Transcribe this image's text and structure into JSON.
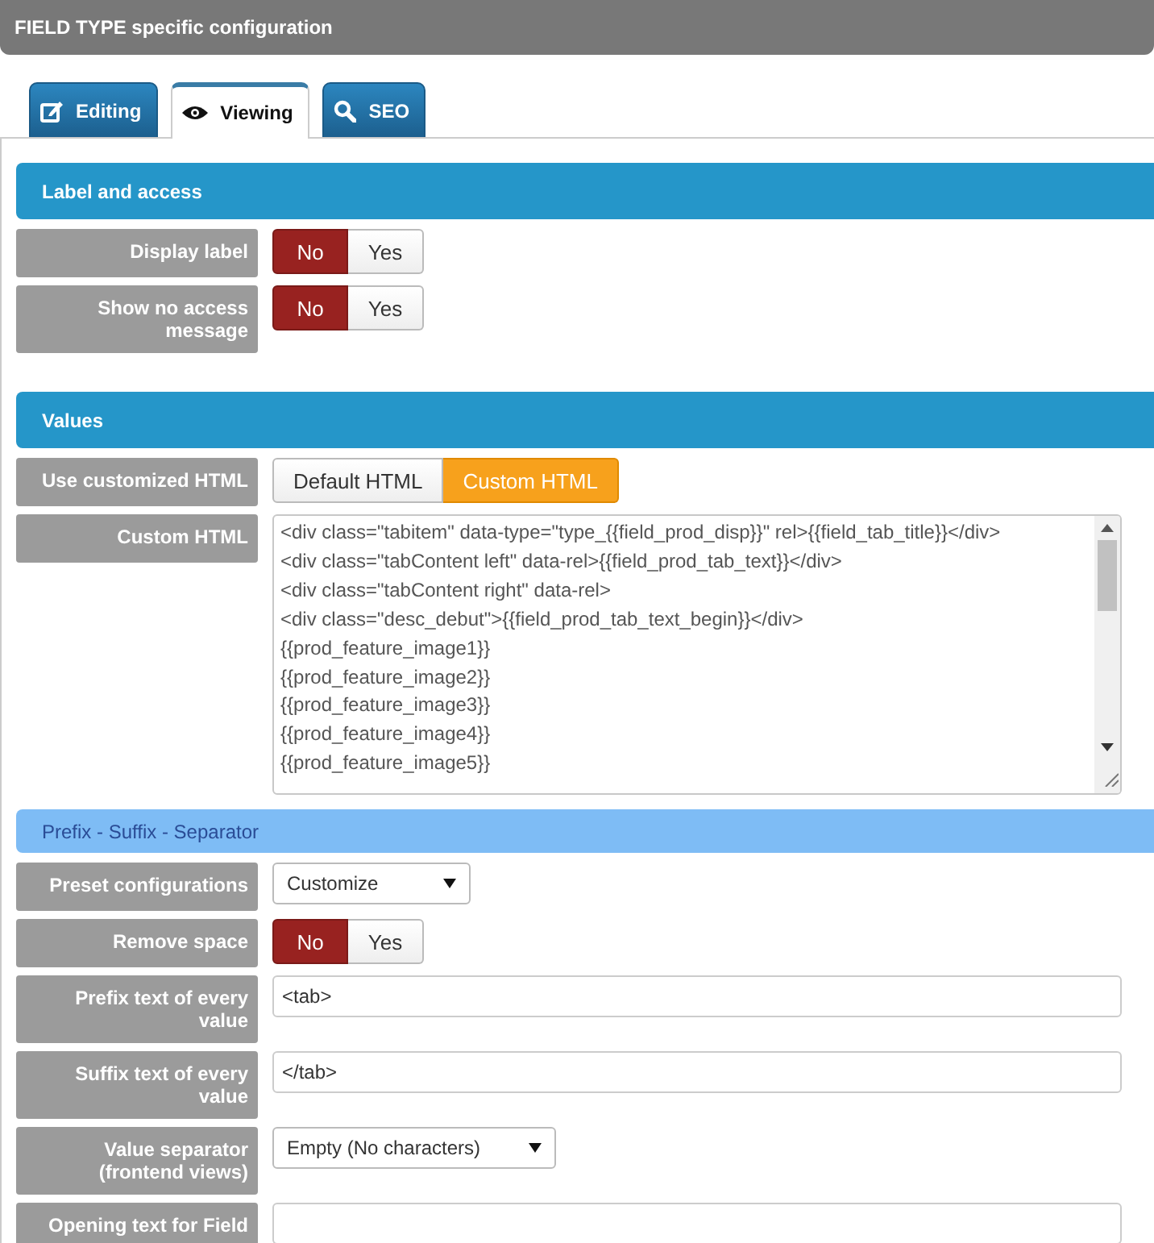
{
  "header": {
    "title": "**FIELD TYPE** specific configuration"
  },
  "tabs": [
    {
      "label": "Editing",
      "selected": false
    },
    {
      "label": "Viewing",
      "selected": true
    },
    {
      "label": "SEO",
      "selected": false
    }
  ],
  "sections": [
    {
      "title": "Label and access",
      "kind": "main",
      "rows": [
        {
          "label": "Display label",
          "kind": "toggle",
          "options": [
            {
              "label": "No",
              "selected": true
            },
            {
              "label": "Yes",
              "selected": false
            }
          ]
        },
        {
          "label": "Show no access message",
          "kind": "toggle",
          "options": [
            {
              "label": "No",
              "selected": true
            },
            {
              "label": "Yes",
              "selected": false
            }
          ]
        }
      ]
    },
    {
      "title": "Values",
      "kind": "main",
      "rows": [
        {
          "label": "Use customized HTML",
          "kind": "choice",
          "options": [
            {
              "label": "Default HTML",
              "selected": false
            },
            {
              "label": "Custom HTML",
              "selected": true
            }
          ]
        },
        {
          "label": "Custom HTML",
          "kind": "code",
          "lines": [
            "<div class=\"tabitem\" data-type=\"type_{{field_prod_disp}}\" rel>{{field_tab_title}}</div>",
            "<div class=\"tabContent left\" data-rel>{{field_prod_tab_text}}</div>",
            "<div class=\"tabContent right\" data-rel>",
            "<div class=\"desc_debut\">{{field_prod_tab_text_begin}}</div>",
            "{{prod_feature_image1}}",
            "{{prod_feature_image2}}",
            "{{prod_feature_image3}}",
            "{{prod_feature_image4}}",
            "{{prod_feature_image5}}"
          ]
        }
      ]
    },
    {
      "title": "Prefix - Suffix - Separator",
      "kind": "sub",
      "rows": [
        {
          "label": "Preset configurations",
          "kind": "select",
          "value": "Customize"
        },
        {
          "label": "Remove space",
          "kind": "toggle",
          "options": [
            {
              "label": "No",
              "selected": true
            },
            {
              "label": "Yes",
              "selected": false
            }
          ]
        },
        {
          "label": "Prefix text of every value",
          "kind": "text",
          "value": "<tab>"
        },
        {
          "label": "Suffix text of every value",
          "kind": "text",
          "value": "</tab>"
        },
        {
          "label": "Value separator (frontend views)",
          "kind": "select",
          "value": "Empty (No characters)"
        },
        {
          "label": "Opening text for Field",
          "kind": "text"
        }
      ]
    }
  ]
}
